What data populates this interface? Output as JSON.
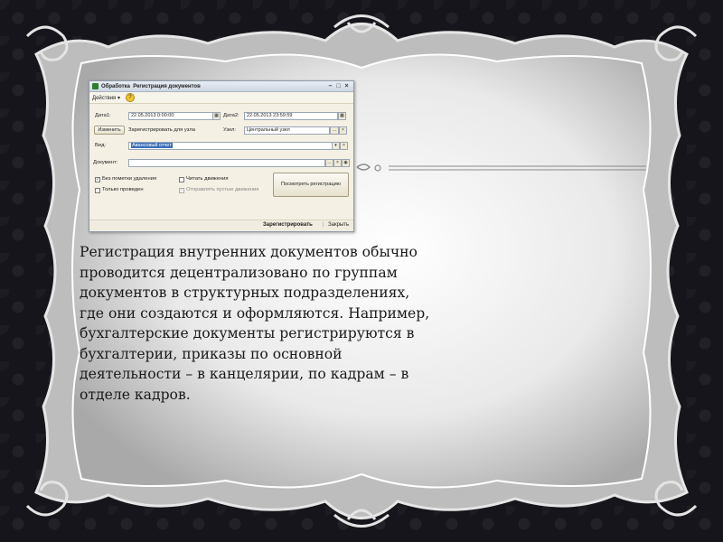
{
  "dialog": {
    "title_prefix": "Обработка",
    "title": "Регистрация документов",
    "toolbar": {
      "actions": "Действия ▾",
      "help": "?"
    },
    "date1_label": "Дата1:",
    "date1_value": "22.05.2013  0:00:00",
    "date2_label": "Дата2:",
    "date2_value": "22.05.2013 23:59:59",
    "change_button": "Изменить",
    "register_for_node": "Зарегистрировать для узла",
    "node_label": "Узел:",
    "node_value": "Центральный узел",
    "type_label": "Вид:",
    "type_value": "Авансовый отчет",
    "document_label": "Документ:",
    "document_value": "",
    "checkboxes": [
      {
        "label": "Без пометки удаления",
        "checked": true
      },
      {
        "label": "Только проведен",
        "checked": false
      },
      {
        "label": "Читать движения",
        "checked": false
      },
      {
        "label": "Отправлять пустые движения",
        "checked": true
      }
    ],
    "view_registration_button": "Посмотреть регистрацию",
    "register_button": "Зарегистрировать",
    "close_button": "Закрыть"
  },
  "main_text": "Регистрация внутренних документов обычно проводится децентрализовано по группам документов в структурных подразделениях, где они создаются и оформляются. Например, бухгалтерские документы регистрируются в бухгалтерии, приказы по основной деятельности – в канцелярии, по кадрам – в отделе кадров.",
  "colors": {
    "background": "#15151b",
    "frame_outer": "#cfcfcf",
    "frame_panel": "#f4f4f4",
    "text": "#1a1a1a",
    "selection": "#3b6fb6"
  }
}
